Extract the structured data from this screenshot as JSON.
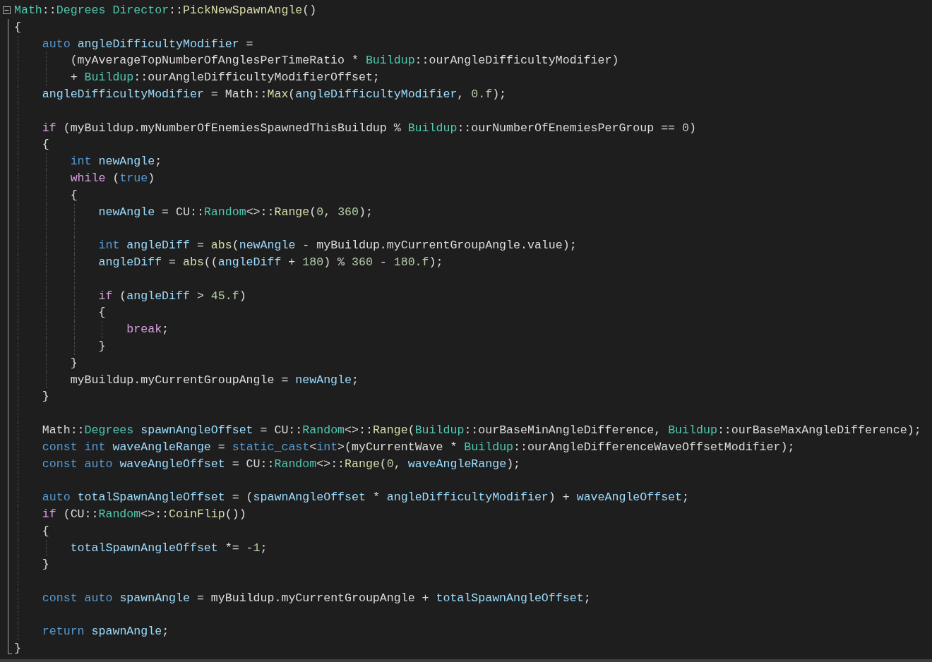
{
  "editor": {
    "lines": [
      {
        "kind": "code",
        "tokens": [
          {
            "kind": "type",
            "text": "Math"
          },
          {
            "kind": "plain",
            "text": "::"
          },
          {
            "kind": "type",
            "text": "Degrees "
          },
          {
            "kind": "type",
            "text": "Director"
          },
          {
            "kind": "plain",
            "text": "::"
          },
          {
            "kind": "function",
            "text": "PickNewSpawnAngle"
          },
          {
            "kind": "plain",
            "text": "()"
          }
        ]
      },
      {
        "kind": "code",
        "tokens": [
          {
            "kind": "plain",
            "text": "{"
          }
        ]
      },
      {
        "kind": "code",
        "tokens": [
          {
            "kind": "keyword",
            "text": "    auto "
          },
          {
            "kind": "variable",
            "text": "angleDifficultyModifier"
          },
          {
            "kind": "plain",
            "text": " ="
          }
        ]
      },
      {
        "kind": "code",
        "tokens": [
          {
            "kind": "plain",
            "text": "        (myAverageTopNumberOfAnglesPerTimeRatio * "
          },
          {
            "kind": "type",
            "text": "Buildup"
          },
          {
            "kind": "plain",
            "text": "::ourAngleDifficultyModifier)"
          }
        ]
      },
      {
        "kind": "code",
        "tokens": [
          {
            "kind": "plain",
            "text": "        + "
          },
          {
            "kind": "type",
            "text": "Buildup"
          },
          {
            "kind": "plain",
            "text": "::ourAngleDifficultyModifierOffset;"
          }
        ]
      },
      {
        "kind": "code",
        "tokens": [
          {
            "kind": "variable",
            "text": "    angleDifficultyModifier"
          },
          {
            "kind": "plain",
            "text": " = Math::"
          },
          {
            "kind": "function",
            "text": "Max"
          },
          {
            "kind": "plain",
            "text": "("
          },
          {
            "kind": "variable",
            "text": "angleDifficultyModifier"
          },
          {
            "kind": "plain",
            "text": ", "
          },
          {
            "kind": "number",
            "text": "0.f"
          },
          {
            "kind": "plain",
            "text": ");"
          }
        ]
      },
      {
        "kind": "blank"
      },
      {
        "kind": "code",
        "tokens": [
          {
            "kind": "control",
            "text": "    if"
          },
          {
            "kind": "plain",
            "text": " (myBuildup.myNumberOfEnemiesSpawnedThisBuildup % "
          },
          {
            "kind": "type",
            "text": "Buildup"
          },
          {
            "kind": "plain",
            "text": "::ourNumberOfEnemiesPerGroup == "
          },
          {
            "kind": "number",
            "text": "0"
          },
          {
            "kind": "plain",
            "text": ")"
          }
        ]
      },
      {
        "kind": "code",
        "tokens": [
          {
            "kind": "plain",
            "text": "    {"
          }
        ]
      },
      {
        "kind": "code",
        "tokens": [
          {
            "kind": "keyword",
            "text": "        int "
          },
          {
            "kind": "variable",
            "text": "newAngle"
          },
          {
            "kind": "plain",
            "text": ";"
          }
        ]
      },
      {
        "kind": "code",
        "tokens": [
          {
            "kind": "control",
            "text": "        while"
          },
          {
            "kind": "plain",
            "text": " ("
          },
          {
            "kind": "keyword",
            "text": "true"
          },
          {
            "kind": "plain",
            "text": ")"
          }
        ]
      },
      {
        "kind": "code",
        "tokens": [
          {
            "kind": "plain",
            "text": "        {"
          }
        ]
      },
      {
        "kind": "code",
        "tokens": [
          {
            "kind": "variable",
            "text": "            newAngle"
          },
          {
            "kind": "plain",
            "text": " = CU::"
          },
          {
            "kind": "type",
            "text": "Random"
          },
          {
            "kind": "plain",
            "text": "<>::"
          },
          {
            "kind": "function",
            "text": "Range"
          },
          {
            "kind": "plain",
            "text": "("
          },
          {
            "kind": "number",
            "text": "0"
          },
          {
            "kind": "plain",
            "text": ", "
          },
          {
            "kind": "number",
            "text": "360"
          },
          {
            "kind": "plain",
            "text": ");"
          }
        ]
      },
      {
        "kind": "blank"
      },
      {
        "kind": "code",
        "tokens": [
          {
            "kind": "keyword",
            "text": "            int "
          },
          {
            "kind": "variable",
            "text": "angleDiff"
          },
          {
            "kind": "plain",
            "text": " = "
          },
          {
            "kind": "function",
            "text": "abs"
          },
          {
            "kind": "plain",
            "text": "("
          },
          {
            "kind": "variable",
            "text": "newAngle"
          },
          {
            "kind": "plain",
            "text": " - myBuildup.myCurrentGroupAngle.value);"
          }
        ]
      },
      {
        "kind": "code",
        "tokens": [
          {
            "kind": "variable",
            "text": "            angleDiff"
          },
          {
            "kind": "plain",
            "text": " = "
          },
          {
            "kind": "function",
            "text": "abs"
          },
          {
            "kind": "plain",
            "text": "(("
          },
          {
            "kind": "variable",
            "text": "angleDiff"
          },
          {
            "kind": "plain",
            "text": " + "
          },
          {
            "kind": "number",
            "text": "180"
          },
          {
            "kind": "plain",
            "text": ") % "
          },
          {
            "kind": "number",
            "text": "360"
          },
          {
            "kind": "plain",
            "text": " - "
          },
          {
            "kind": "number",
            "text": "180.f"
          },
          {
            "kind": "plain",
            "text": ");"
          }
        ]
      },
      {
        "kind": "blank"
      },
      {
        "kind": "code",
        "tokens": [
          {
            "kind": "control",
            "text": "            if"
          },
          {
            "kind": "plain",
            "text": " ("
          },
          {
            "kind": "variable",
            "text": "angleDiff"
          },
          {
            "kind": "plain",
            "text": " > "
          },
          {
            "kind": "number",
            "text": "45.f"
          },
          {
            "kind": "plain",
            "text": ")"
          }
        ]
      },
      {
        "kind": "code",
        "tokens": [
          {
            "kind": "plain",
            "text": "            {"
          }
        ]
      },
      {
        "kind": "code",
        "tokens": [
          {
            "kind": "control",
            "text": "                break"
          },
          {
            "kind": "plain",
            "text": ";"
          }
        ]
      },
      {
        "kind": "code",
        "tokens": [
          {
            "kind": "plain",
            "text": "            }"
          }
        ]
      },
      {
        "kind": "code",
        "tokens": [
          {
            "kind": "plain",
            "text": "        }"
          }
        ]
      },
      {
        "kind": "code",
        "tokens": [
          {
            "kind": "plain",
            "text": "        myBuildup.myCurrentGroupAngle = "
          },
          {
            "kind": "variable",
            "text": "newAngle"
          },
          {
            "kind": "plain",
            "text": ";"
          }
        ]
      },
      {
        "kind": "code",
        "tokens": [
          {
            "kind": "plain",
            "text": "    }"
          }
        ]
      },
      {
        "kind": "blank"
      },
      {
        "kind": "code",
        "tokens": [
          {
            "kind": "plain",
            "text": "    Math::"
          },
          {
            "kind": "type",
            "text": "Degrees "
          },
          {
            "kind": "variable",
            "text": "spawnAngleOffset"
          },
          {
            "kind": "plain",
            "text": " = CU::"
          },
          {
            "kind": "type",
            "text": "Random"
          },
          {
            "kind": "plain",
            "text": "<>::"
          },
          {
            "kind": "function",
            "text": "Range"
          },
          {
            "kind": "plain",
            "text": "("
          },
          {
            "kind": "type",
            "text": "Buildup"
          },
          {
            "kind": "plain",
            "text": "::ourBaseMinAngleDifference, "
          },
          {
            "kind": "type",
            "text": "Buildup"
          },
          {
            "kind": "plain",
            "text": "::ourBaseMaxAngleDifference);"
          }
        ]
      },
      {
        "kind": "code",
        "tokens": [
          {
            "kind": "keyword",
            "text": "    const int "
          },
          {
            "kind": "variable",
            "text": "waveAngleRange"
          },
          {
            "kind": "plain",
            "text": " = "
          },
          {
            "kind": "keyword",
            "text": "static_cast"
          },
          {
            "kind": "plain",
            "text": "<"
          },
          {
            "kind": "keyword",
            "text": "int"
          },
          {
            "kind": "plain",
            "text": ">(myCurrentWave * "
          },
          {
            "kind": "type",
            "text": "Buildup"
          },
          {
            "kind": "plain",
            "text": "::ourAngleDifferenceWaveOffsetModifier);"
          }
        ]
      },
      {
        "kind": "code",
        "tokens": [
          {
            "kind": "keyword",
            "text": "    const auto "
          },
          {
            "kind": "variable",
            "text": "waveAngleOffset"
          },
          {
            "kind": "plain",
            "text": " = CU::"
          },
          {
            "kind": "type",
            "text": "Random"
          },
          {
            "kind": "plain",
            "text": "<>::"
          },
          {
            "kind": "function",
            "text": "Range"
          },
          {
            "kind": "plain",
            "text": "("
          },
          {
            "kind": "number",
            "text": "0"
          },
          {
            "kind": "plain",
            "text": ", "
          },
          {
            "kind": "variable",
            "text": "waveAngleRange"
          },
          {
            "kind": "plain",
            "text": ");"
          }
        ]
      },
      {
        "kind": "blank"
      },
      {
        "kind": "code",
        "tokens": [
          {
            "kind": "keyword",
            "text": "    auto "
          },
          {
            "kind": "variable",
            "text": "totalSpawnAngleOffset"
          },
          {
            "kind": "plain",
            "text": " = ("
          },
          {
            "kind": "variable",
            "text": "spawnAngleOffset"
          },
          {
            "kind": "plain",
            "text": " * "
          },
          {
            "kind": "variable",
            "text": "angleDifficultyModifier"
          },
          {
            "kind": "plain",
            "text": ") + "
          },
          {
            "kind": "variable",
            "text": "waveAngleOffset"
          },
          {
            "kind": "plain",
            "text": ";"
          }
        ]
      },
      {
        "kind": "code",
        "tokens": [
          {
            "kind": "control",
            "text": "    if"
          },
          {
            "kind": "plain",
            "text": " (CU::"
          },
          {
            "kind": "type",
            "text": "Random"
          },
          {
            "kind": "plain",
            "text": "<>::"
          },
          {
            "kind": "function",
            "text": "CoinFlip"
          },
          {
            "kind": "plain",
            "text": "())"
          }
        ]
      },
      {
        "kind": "code",
        "tokens": [
          {
            "kind": "plain",
            "text": "    {"
          }
        ]
      },
      {
        "kind": "code",
        "tokens": [
          {
            "kind": "variable",
            "text": "        totalSpawnAngleOffset"
          },
          {
            "kind": "plain",
            "text": " *= -"
          },
          {
            "kind": "number",
            "text": "1"
          },
          {
            "kind": "plain",
            "text": ";"
          }
        ]
      },
      {
        "kind": "code",
        "tokens": [
          {
            "kind": "plain",
            "text": "    }"
          }
        ]
      },
      {
        "kind": "blank"
      },
      {
        "kind": "code",
        "tokens": [
          {
            "kind": "keyword",
            "text": "    const auto "
          },
          {
            "kind": "variable",
            "text": "spawnAngle"
          },
          {
            "kind": "plain",
            "text": " = myBuildup.myCurrentGroupAngle + "
          },
          {
            "kind": "variable",
            "text": "totalSpawnAngleOffset"
          },
          {
            "kind": "plain",
            "text": ";"
          }
        ]
      },
      {
        "kind": "blank"
      },
      {
        "kind": "code",
        "tokens": [
          {
            "kind": "keyword",
            "text": "    return "
          },
          {
            "kind": "variable",
            "text": "spawnAngle"
          },
          {
            "kind": "plain",
            "text": ";"
          }
        ]
      },
      {
        "kind": "code",
        "tokens": [
          {
            "kind": "plain",
            "text": "}"
          }
        ]
      }
    ]
  }
}
